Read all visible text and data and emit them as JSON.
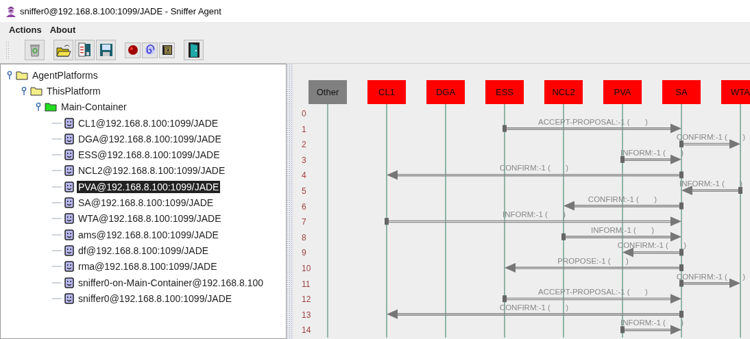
{
  "window": {
    "title": "sniffer0@192.168.8.100:1099/JADE - Sniffer Agent"
  },
  "menu": [
    "Actions",
    "About"
  ],
  "tree": [
    {
      "label": "AgentPlatforms",
      "kind": "folder",
      "expanded": true,
      "selected": false,
      "children": [
        {
          "label": "ThisPlatform",
          "kind": "folder",
          "expanded": true,
          "selected": false,
          "children": [
            {
              "label": "Main-Container",
              "kind": "container",
              "expanded": true,
              "selected": false,
              "children": [
                {
                  "label": "CL1@192.168.8.100:1099/JADE",
                  "kind": "agent",
                  "selected": false
                },
                {
                  "label": "DGA@192.168.8.100:1099/JADE",
                  "kind": "agent",
                  "selected": false
                },
                {
                  "label": "ESS@192.168.8.100:1099/JADE",
                  "kind": "agent",
                  "selected": false
                },
                {
                  "label": "NCL2@192.168.8.100:1099/JADE",
                  "kind": "agent",
                  "selected": false
                },
                {
                  "label": "PVA@192.168.8.100:1099/JADE",
                  "kind": "agent",
                  "selected": true
                },
                {
                  "label": "SA@192.168.8.100:1099/JADE",
                  "kind": "agent",
                  "selected": false
                },
                {
                  "label": "WTA@192.168.8.100:1099/JADE",
                  "kind": "agent",
                  "selected": false
                },
                {
                  "label": "ams@192.168.8.100:1099/JADE",
                  "kind": "agent",
                  "selected": false
                },
                {
                  "label": "df@192.168.8.100:1099/JADE",
                  "kind": "agent",
                  "selected": false
                },
                {
                  "label": "rma@192.168.8.100:1099/JADE",
                  "kind": "agent",
                  "selected": false
                },
                {
                  "label": "sniffer0-on-Main-Container@192.168.8.100",
                  "kind": "agent",
                  "selected": false
                },
                {
                  "label": "sniffer0@192.168.8.100:1099/JADE",
                  "kind": "agent",
                  "selected": false
                }
              ]
            }
          ]
        }
      ]
    }
  ],
  "agents": [
    {
      "name": "Other",
      "color": "#808080"
    },
    {
      "name": "CL1",
      "color": "#ff0000"
    },
    {
      "name": "DGA",
      "color": "#ff0000"
    },
    {
      "name": "ESS",
      "color": "#ff0000"
    },
    {
      "name": "NCL2",
      "color": "#ff0000"
    },
    {
      "name": "PVA",
      "color": "#ff0000"
    },
    {
      "name": "SA",
      "color": "#ff0000"
    },
    {
      "name": "WTA",
      "color": "#ff0000"
    }
  ],
  "row_numbers": [
    "0",
    "1",
    "2",
    "3",
    "4",
    "5",
    "6",
    "7",
    "8",
    "9",
    "10",
    "11",
    "12",
    "13",
    "14"
  ],
  "messages": [
    {
      "label": "ACCEPT-PROPOSAL:-1 (       )"
    },
    {
      "label": "CONFIRM:-1 (       )"
    },
    {
      "label": "INFORM:-1 (       )"
    },
    {
      "label": "CONFIRM:-1 (       )"
    },
    {
      "label": "INFORM:-1 (       )"
    },
    {
      "label": "CONFIRM:-1 (       )"
    },
    {
      "label": "INFORM:-1 (       )"
    },
    {
      "label": "INFORM:-1 (       )"
    },
    {
      "label": "CONFIRM:-1 (       )"
    },
    {
      "label": "PROPOSE:-1 (       )"
    },
    {
      "label": "CONFIRM:-1 (       )"
    },
    {
      "label": "ACCEPT-PROPOSAL:-1 (       )"
    },
    {
      "label": "CONFIRM:-1 (       )"
    },
    {
      "label": "INFORM:-1 (       )"
    }
  ]
}
